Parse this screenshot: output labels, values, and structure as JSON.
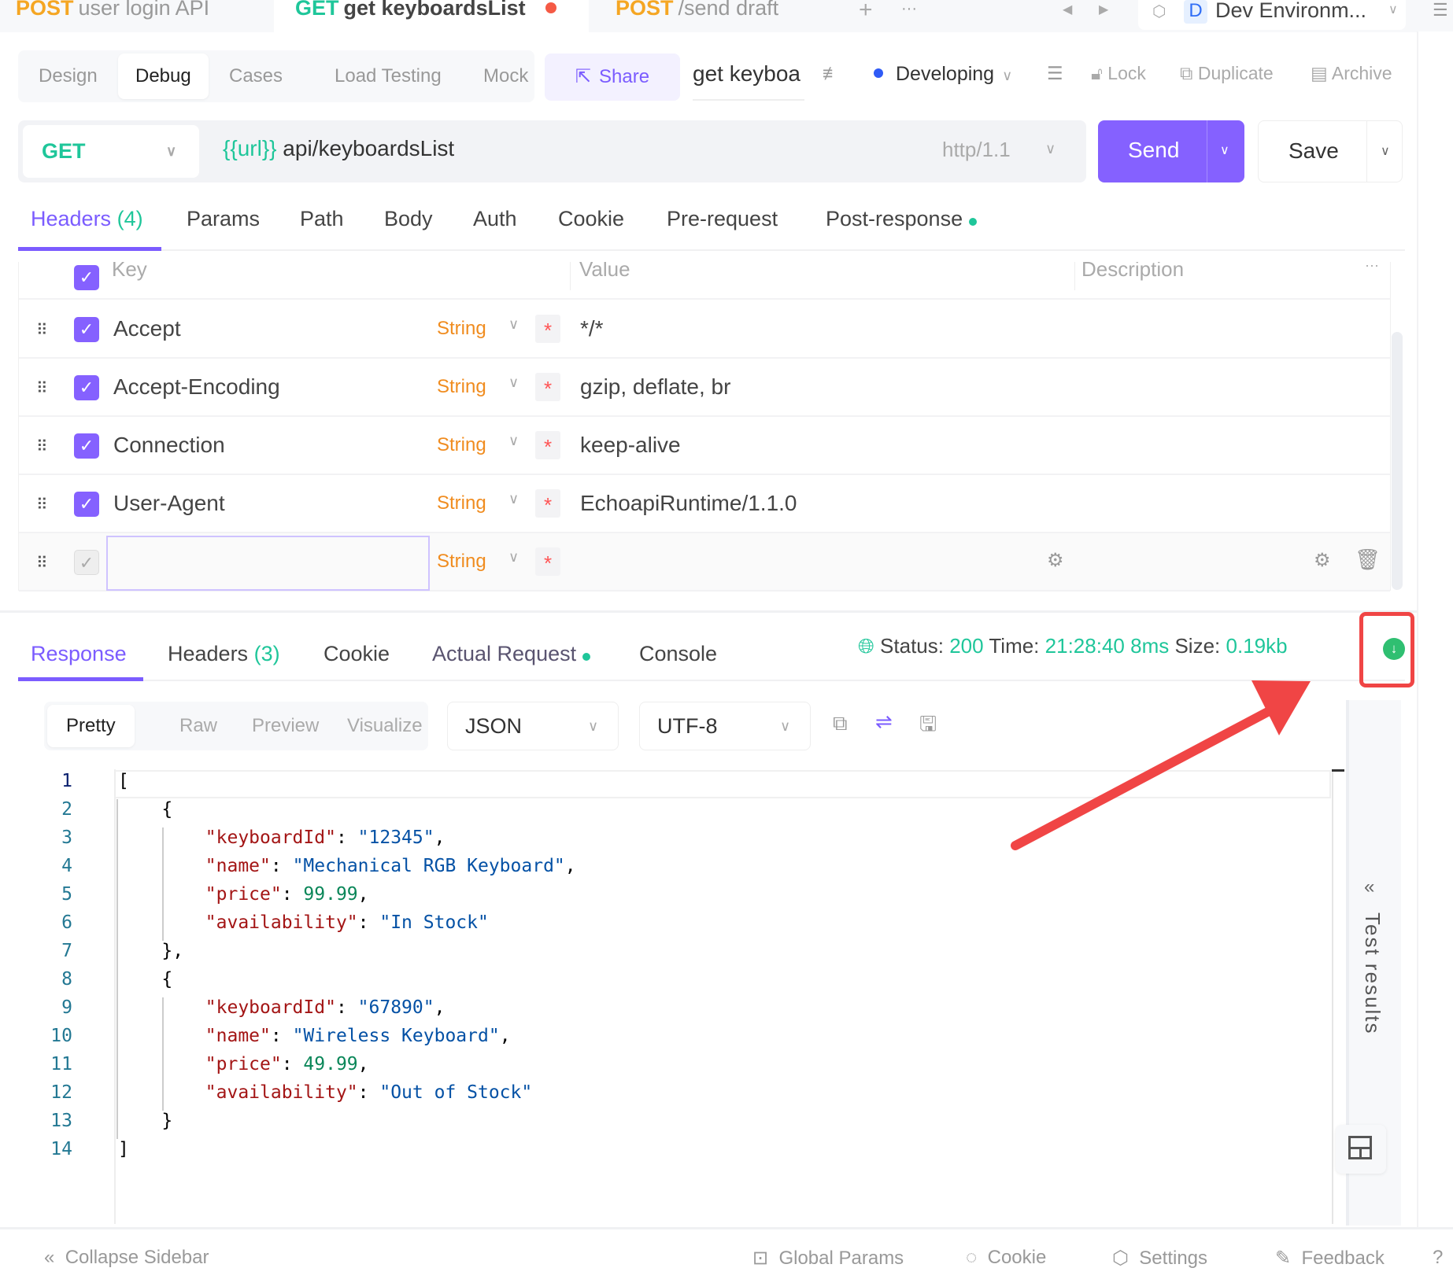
{
  "file_tabs": [
    {
      "method": "POST",
      "name": "user login API",
      "method_color": "#f5a623",
      "active": false
    },
    {
      "method": "GET",
      "name": "get keyboardsList",
      "method_color": "#1fc69a",
      "active": true,
      "unsaved": true
    },
    {
      "method": "POST",
      "name": "/send draft",
      "method_color": "#f5a623",
      "active": false
    }
  ],
  "tab_actions": {
    "add": "+",
    "more": "···",
    "prev": "◀",
    "next": "▶"
  },
  "environment": {
    "badge": "D",
    "name": "Dev Environm..."
  },
  "mode_tabs": [
    "Design",
    "Debug",
    "Cases",
    "Load Testing",
    "Mock"
  ],
  "mode_selected": "Debug",
  "share_label": "Share",
  "api_name": "get keyboa",
  "status_label": "Developing",
  "toolbar": {
    "lock": "Lock",
    "duplicate": "Duplicate",
    "archive": "Archive"
  },
  "request": {
    "method": "GET",
    "url_var": "{{url}}",
    "url_path": " api/keyboardsList",
    "protocol": "http/1.1",
    "send_label": "Send",
    "save_label": "Save"
  },
  "request_tabs": [
    {
      "label": "Headers",
      "count": "(4)"
    },
    {
      "label": "Params"
    },
    {
      "label": "Path"
    },
    {
      "label": "Body"
    },
    {
      "label": "Auth"
    },
    {
      "label": "Cookie"
    },
    {
      "label": "Pre-request"
    },
    {
      "label": "Post-response",
      "dot": true
    }
  ],
  "headers_table": {
    "columns": {
      "key": "Key",
      "value": "Value",
      "description": "Description",
      "more": "···"
    },
    "rows": [
      {
        "key": "Accept",
        "type": "String",
        "value": "*/*",
        "checked": true
      },
      {
        "key": "Accept-Encoding",
        "type": "String",
        "value": "gzip, deflate, br",
        "checked": true
      },
      {
        "key": "Connection",
        "type": "String",
        "value": "keep-alive",
        "checked": true
      },
      {
        "key": "User-Agent",
        "type": "String",
        "value": "EchoapiRuntime/1.1.0",
        "checked": true
      }
    ],
    "new_row": {
      "key": "",
      "type": "String"
    }
  },
  "response_tabs": [
    {
      "label": "Response"
    },
    {
      "label": "Headers",
      "count": "(3)"
    },
    {
      "label": "Cookie"
    },
    {
      "label": "Actual Request",
      "dot": true
    },
    {
      "label": "Console"
    }
  ],
  "response_status": {
    "status_label": "Status:",
    "status": "200",
    "time_label": "Time:",
    "time": "21:28:40",
    "duration": "8ms",
    "size_label": "Size:",
    "size": "0.19kb"
  },
  "format_tabs": [
    "Pretty",
    "Raw",
    "Preview",
    "Visualize"
  ],
  "format_selected": "Pretty",
  "body_type": "JSON",
  "encoding": "UTF-8",
  "code_lines": [
    [
      [
        "p",
        "["
      ]
    ],
    [
      [
        "p",
        "    {"
      ]
    ],
    [
      [
        "p",
        "        "
      ],
      [
        "k",
        "\"keyboardId\""
      ],
      [
        "p",
        ": "
      ],
      [
        "s",
        "\"12345\""
      ],
      [
        "p",
        ","
      ]
    ],
    [
      [
        "p",
        "        "
      ],
      [
        "k",
        "\"name\""
      ],
      [
        "p",
        ": "
      ],
      [
        "s",
        "\"Mechanical RGB Keyboard\""
      ],
      [
        "p",
        ","
      ]
    ],
    [
      [
        "p",
        "        "
      ],
      [
        "k",
        "\"price\""
      ],
      [
        "p",
        ": "
      ],
      [
        "n",
        "99.99"
      ],
      [
        "p",
        ","
      ]
    ],
    [
      [
        "p",
        "        "
      ],
      [
        "k",
        "\"availability\""
      ],
      [
        "p",
        ": "
      ],
      [
        "s",
        "\"In Stock\""
      ]
    ],
    [
      [
        "p",
        "    },"
      ]
    ],
    [
      [
        "p",
        "    {"
      ]
    ],
    [
      [
        "p",
        "        "
      ],
      [
        "k",
        "\"keyboardId\""
      ],
      [
        "p",
        ": "
      ],
      [
        "s",
        "\"67890\""
      ],
      [
        "p",
        ","
      ]
    ],
    [
      [
        "p",
        "        "
      ],
      [
        "k",
        "\"name\""
      ],
      [
        "p",
        ": "
      ],
      [
        "s",
        "\"Wireless Keyboard\""
      ],
      [
        "p",
        ","
      ]
    ],
    [
      [
        "p",
        "        "
      ],
      [
        "k",
        "\"price\""
      ],
      [
        "p",
        ": "
      ],
      [
        "n",
        "49.99"
      ],
      [
        "p",
        ","
      ]
    ],
    [
      [
        "p",
        "        "
      ],
      [
        "k",
        "\"availability\""
      ],
      [
        "p",
        ": "
      ],
      [
        "s",
        "\"Out of Stock\""
      ]
    ],
    [
      [
        "p",
        "    }"
      ]
    ],
    [
      [
        "p",
        "]"
      ]
    ]
  ],
  "test_results_label": "Test results",
  "bottom_bar": {
    "collapse": "Collapse Sidebar",
    "global_params": "Global Params",
    "cookie": "Cookie",
    "settings": "Settings",
    "feedback": "Feedback"
  },
  "colors": {
    "accent": "#8561ff",
    "success": "#1fc69a",
    "annotation": "#f04545"
  }
}
